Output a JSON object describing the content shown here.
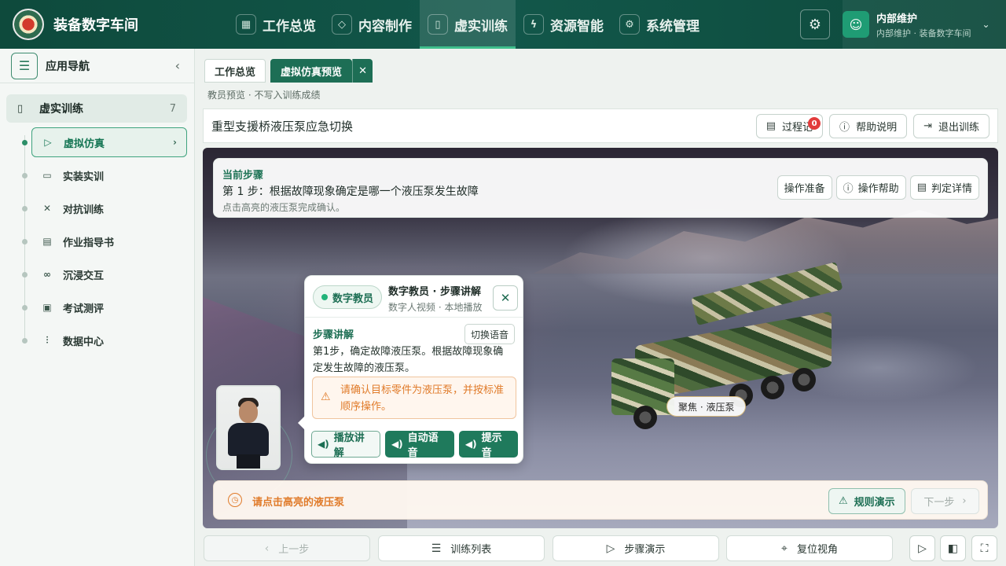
{
  "app": {
    "name": "装备数字车间"
  },
  "topnav": [
    {
      "label": "工作总览",
      "icon": "grid-icon"
    },
    {
      "label": "内容制作",
      "icon": "cube-icon"
    },
    {
      "label": "虚实训练",
      "icon": "book-icon",
      "active": true
    },
    {
      "label": "资源智能",
      "icon": "bolt-icon"
    },
    {
      "label": "系统管理",
      "icon": "gear-icon"
    }
  ],
  "user": {
    "name": "内部维护",
    "subtitle": "内部维护 · 装备数字车间"
  },
  "sidebar": {
    "title": "应用导航",
    "group": {
      "label": "虚实训练",
      "count": "7"
    },
    "items": [
      {
        "label": "虚拟仿真",
        "icon": "play-circle-icon",
        "active": true
      },
      {
        "label": "实装实训",
        "icon": "monitor-icon"
      },
      {
        "label": "对抗训练",
        "icon": "swords-icon"
      },
      {
        "label": "作业指导书",
        "icon": "document-icon"
      },
      {
        "label": "沉浸交互",
        "icon": "vr-icon"
      },
      {
        "label": "考试测评",
        "icon": "exam-icon"
      },
      {
        "label": "数据中心",
        "icon": "chart-icon"
      }
    ]
  },
  "tabs": [
    {
      "label": "工作总览"
    },
    {
      "label": "虚拟仿真预览",
      "active": true
    }
  ],
  "preview_note": "教员预览 · 不写入训练成绩",
  "page": {
    "title": "重型支援桥液压泵应急切换",
    "buttons": {
      "record": "过程记",
      "record_badge": "0",
      "help": "帮助说明",
      "exit": "退出训练"
    }
  },
  "step": {
    "heading": "当前步骤",
    "main": "第 1 步：根据故障现象确定是哪一个液压泵发生故障",
    "hint": "点击高亮的液压泵完成确认。",
    "buttons": {
      "prepare": "操作准备",
      "help": "操作帮助",
      "judge": "判定详情"
    }
  },
  "focus_label": "聚焦 · 液压泵",
  "tutor": {
    "tag": "数字教员",
    "title": "数字教员 · 步骤讲解",
    "subtitle": "数字人视频 · 本地播放",
    "section": "步骤讲解",
    "switch_voice": "切换语音",
    "text": "第1步，确定故障液压泵。根据故障现象确定发生故障的液压泵。",
    "warning": "请确认目标零件为液压泵，并按标准顺序操作。",
    "actions": {
      "play": "播放讲解",
      "auto_voice": "自动语音",
      "beep": "提示音"
    }
  },
  "hint_bar": {
    "text": "请点击高亮的液压泵",
    "rule_demo": "规则演示",
    "next": "下一步"
  },
  "bottom": {
    "prev": "上一步",
    "list": "训练列表",
    "demo": "步骤演示",
    "reset": "复位视角"
  },
  "colors": {
    "brand": "#12574a",
    "accent": "#1f7a5c",
    "warning": "#e07b2a",
    "badge": "#e23b3b"
  }
}
